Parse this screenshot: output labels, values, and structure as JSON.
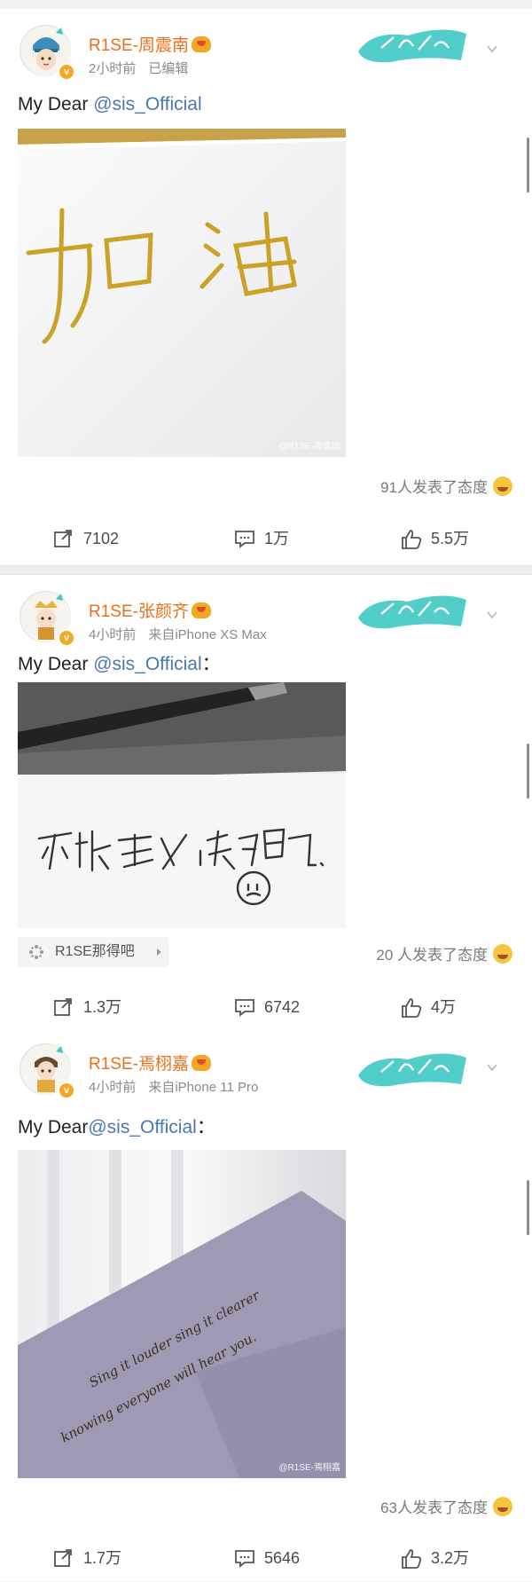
{
  "posts": [
    {
      "username": "R1SE-周震南",
      "time": "2小时前",
      "extra": "已编辑",
      "text_prefix": "My Dear ",
      "mention": "@sis_Official",
      "text_suffix": "",
      "reactions": "91人发表了态度",
      "repost": "7102",
      "comment": "1万",
      "like": "5.5万",
      "photo_handwriting": "加油",
      "watermark": "@R1SE-周震南"
    },
    {
      "username": "R1SE-张颜齐",
      "time": "4小时前",
      "extra": "来自iPhone XS Max",
      "text_prefix": "My Dear ",
      "mention": "@sis_Official",
      "text_suffix": "：",
      "tag": "R1SE那得吧",
      "reactions": "20 人发表了态度",
      "repost": "1.3万",
      "comment": "6742",
      "like": "4万",
      "photo_handwriting": "不被定义，成为自己。"
    },
    {
      "username": "R1SE-焉栩嘉",
      "time": "4小时前",
      "extra": "来自iPhone 11 Pro",
      "text_prefix": "My Dear",
      "mention": "@sis_Official",
      "text_suffix": "：",
      "reactions": "63人发表了态度",
      "repost": "1.7万",
      "comment": "5646",
      "like": "3.2万",
      "photo_handwriting_1": "Sing it louder sing it clearer",
      "photo_handwriting_2": "knowing everyone will hear you.",
      "watermark": "@R1SE-焉栩嘉"
    }
  ],
  "icons": {
    "repost": "repost-icon",
    "comment": "comment-icon",
    "like": "thumbs-up-icon",
    "verified": "verified-badge-icon",
    "member": "crown-icon",
    "more": "chevron-down-icon",
    "reaction": "laugh-emoji-icon"
  },
  "colors": {
    "username": "#e8701a",
    "mention": "#4a78b0",
    "card": "#3ec8c4"
  }
}
